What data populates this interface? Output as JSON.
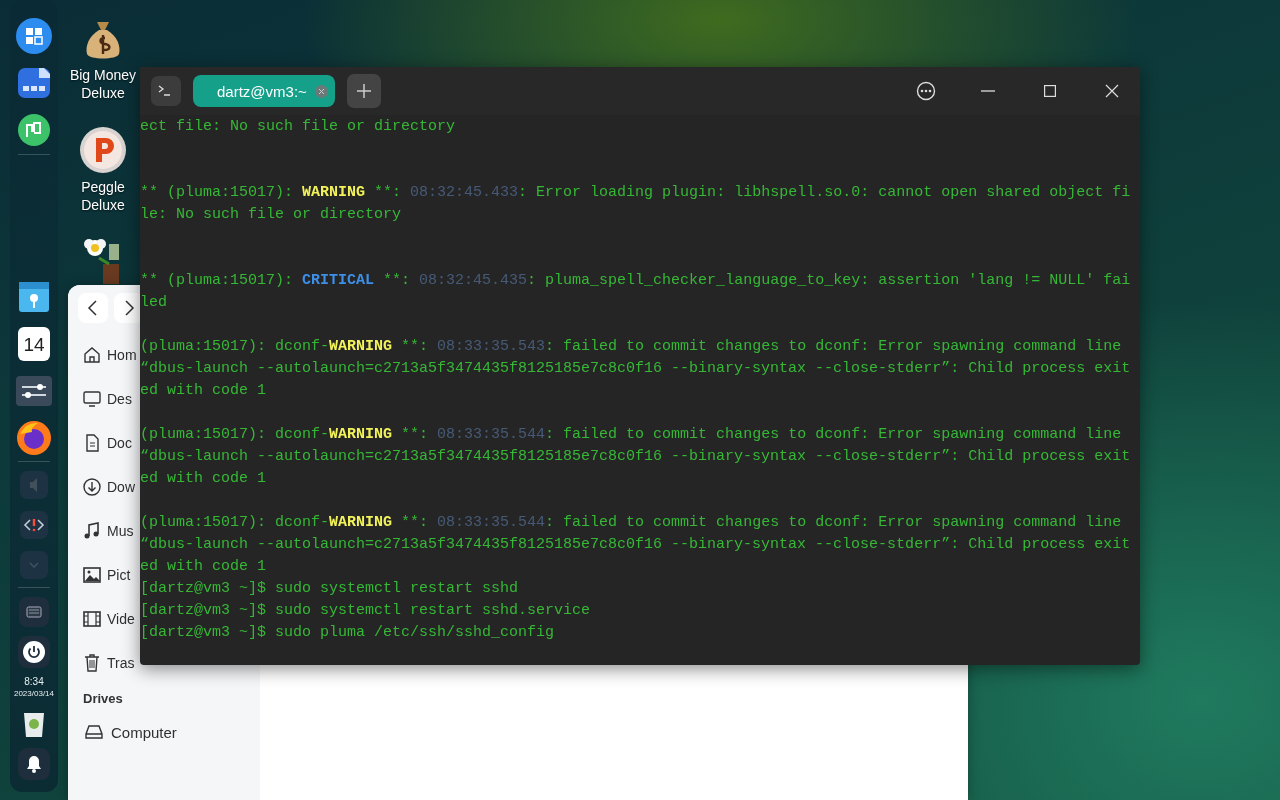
{
  "dock": {
    "pinned": [
      {
        "kind": "launcher"
      },
      {
        "kind": "files"
      },
      {
        "kind": "store"
      }
    ],
    "apps": [
      {
        "kind": "notes"
      },
      {
        "kind": "calendar",
        "day": "14"
      },
      {
        "kind": "settings"
      },
      {
        "kind": "browser"
      }
    ],
    "tray": [
      {
        "kind": "speaker"
      },
      {
        "kind": "code"
      },
      {
        "kind": "chevron"
      }
    ],
    "system": [
      {
        "kind": "keyboard"
      },
      {
        "kind": "power"
      }
    ],
    "clock": {
      "time": "8:34",
      "date": "2023/03/14"
    },
    "bottom": [
      {
        "kind": "trash"
      },
      {
        "kind": "bell"
      }
    ]
  },
  "desktop_icons": [
    {
      "kind": "money",
      "label": "Big Money\nDeluxe"
    },
    {
      "kind": "ball",
      "label": "Peggle\nDeluxe"
    },
    {
      "kind": "flower"
    }
  ],
  "file_manager": {
    "sidebar": [
      {
        "kind": "home",
        "label": "Hom"
      },
      {
        "kind": "desktop",
        "label": "Des"
      },
      {
        "kind": "document",
        "label": "Doc"
      },
      {
        "kind": "download",
        "label": "Dow"
      },
      {
        "kind": "music",
        "label": "Mus"
      },
      {
        "kind": "picture",
        "label": "Pict"
      },
      {
        "kind": "video",
        "label": "Vide"
      },
      {
        "kind": "trash",
        "label": "Tras"
      }
    ],
    "drives_heading": "Drives",
    "drives": [
      {
        "kind": "drive",
        "label": "Computer"
      }
    ]
  },
  "terminal": {
    "tabs": [
      {
        "label": "dartz@vm3:~",
        "selected": true
      }
    ],
    "lines": [
      {
        "kind": "text",
        "segments": [
          {
            "kind": "plain",
            "text": "ect file: No such file or directory"
          }
        ]
      },
      {
        "kind": "blank"
      },
      {
        "kind": "blank"
      },
      {
        "kind": "text",
        "segments": [
          {
            "kind": "plain",
            "text": "** (pluma:15017): "
          },
          {
            "kind": "warning",
            "text": "WARNING"
          },
          {
            "kind": "plain",
            "text": " **: "
          },
          {
            "kind": "time",
            "text": "08:32:45.433"
          },
          {
            "kind": "plain",
            "text": ": Error loading plugin: libhspell.so.0: cannot open shared object fi"
          }
        ]
      },
      {
        "kind": "text",
        "segments": [
          {
            "kind": "plain",
            "text": "le: No such file or directory"
          }
        ]
      },
      {
        "kind": "blank"
      },
      {
        "kind": "blank"
      },
      {
        "kind": "text",
        "segments": [
          {
            "kind": "plain",
            "text": "** (pluma:15017): "
          },
          {
            "kind": "critical",
            "text": "CRITICAL"
          },
          {
            "kind": "plain",
            "text": " **: "
          },
          {
            "kind": "time",
            "text": "08:32:45.435"
          },
          {
            "kind": "plain",
            "text": ": pluma_spell_checker_language_to_key: assertion 'lang != NULL' fai"
          }
        ]
      },
      {
        "kind": "text",
        "segments": [
          {
            "kind": "plain",
            "text": "led"
          }
        ]
      },
      {
        "kind": "blank"
      },
      {
        "kind": "text",
        "segments": [
          {
            "kind": "plain",
            "text": "(pluma:15017): dconf-"
          },
          {
            "kind": "warning",
            "text": "WARNING"
          },
          {
            "kind": "plain",
            "text": " **: "
          },
          {
            "kind": "time",
            "text": "08:33:35.543"
          },
          {
            "kind": "plain",
            "text": ": failed to commit changes to dconf: Error spawning command line"
          }
        ]
      },
      {
        "kind": "text",
        "segments": [
          {
            "kind": "plain",
            "text": "“dbus-launch --autolaunch=c2713a5f3474435f8125185e7c8c0f16 --binary-syntax --close-stderr”: Child process exit"
          }
        ]
      },
      {
        "kind": "text",
        "segments": [
          {
            "kind": "plain",
            "text": "ed with code 1"
          }
        ]
      },
      {
        "kind": "blank"
      },
      {
        "kind": "text",
        "segments": [
          {
            "kind": "plain",
            "text": "(pluma:15017): dconf-"
          },
          {
            "kind": "warning",
            "text": "WARNING"
          },
          {
            "kind": "plain",
            "text": " **: "
          },
          {
            "kind": "time",
            "text": "08:33:35.544"
          },
          {
            "kind": "plain",
            "text": ": failed to commit changes to dconf: Error spawning command line"
          }
        ]
      },
      {
        "kind": "text",
        "segments": [
          {
            "kind": "plain",
            "text": "“dbus-launch --autolaunch=c2713a5f3474435f8125185e7c8c0f16 --binary-syntax --close-stderr”: Child process exit"
          }
        ]
      },
      {
        "kind": "text",
        "segments": [
          {
            "kind": "plain",
            "text": "ed with code 1"
          }
        ]
      },
      {
        "kind": "blank"
      },
      {
        "kind": "text",
        "segments": [
          {
            "kind": "plain",
            "text": "(pluma:15017): dconf-"
          },
          {
            "kind": "warning",
            "text": "WARNING"
          },
          {
            "kind": "plain",
            "text": " **: "
          },
          {
            "kind": "time",
            "text": "08:33:35.544"
          },
          {
            "kind": "plain",
            "text": ": failed to commit changes to dconf: Error spawning command line"
          }
        ]
      },
      {
        "kind": "text",
        "segments": [
          {
            "kind": "plain",
            "text": "“dbus-launch --autolaunch=c2713a5f3474435f8125185e7c8c0f16 --binary-syntax --close-stderr”: Child process exit"
          }
        ]
      },
      {
        "kind": "text",
        "segments": [
          {
            "kind": "plain",
            "text": "ed with code 1"
          }
        ]
      },
      {
        "kind": "text",
        "segments": [
          {
            "kind": "plain",
            "text": "[dartz@vm3 ~]$ sudo systemctl restart sshd"
          }
        ]
      },
      {
        "kind": "text",
        "segments": [
          {
            "kind": "plain",
            "text": "[dartz@vm3 ~]$ sudo systemctl restart sshd.service"
          }
        ]
      },
      {
        "kind": "text",
        "segments": [
          {
            "kind": "plain",
            "text": "[dartz@vm3 ~]$ sudo pluma /etc/ssh/sshd_config"
          }
        ]
      }
    ]
  }
}
